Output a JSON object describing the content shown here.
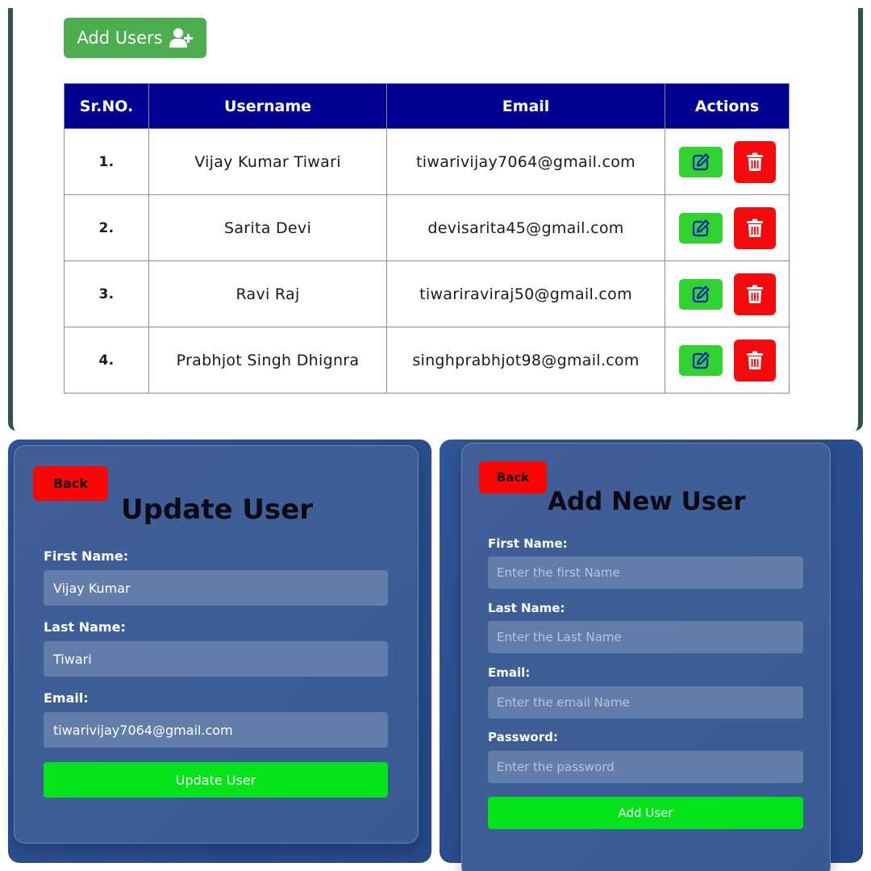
{
  "users_table": {
    "add_button_label": "Add Users",
    "columns": [
      "Sr.NO.",
      "Username",
      "Email",
      "Actions"
    ],
    "rows": [
      {
        "num": "1.",
        "username": "Vijay Kumar Tiwari",
        "email": "tiwarivijay7064@gmail.com"
      },
      {
        "num": "2.",
        "username": "Sarita Devi",
        "email": "devisarita45@gmail.com"
      },
      {
        "num": "3.",
        "username": "Ravi Raj",
        "email": "tiwariraviraj50@gmail.com"
      },
      {
        "num": "4.",
        "username": "Prabhjot Singh Dhignra",
        "email": "singhprabhjot98@gmail.com"
      }
    ],
    "action_icons": [
      "edit-icon",
      "trash-icon"
    ]
  },
  "update_form": {
    "back_label": "Back",
    "title": "Update User",
    "first_name_label": "First Name:",
    "first_name_value": "Vijay Kumar",
    "last_name_label": "Last Name:",
    "last_name_value": "Tiwari",
    "email_label": "Email:",
    "email_value": "tiwarivijay7064@gmail.com",
    "submit_label": "Update User"
  },
  "add_form": {
    "back_label": "Back",
    "title": "Add New User",
    "first_name_label": "First Name:",
    "first_name_placeholder": "Enter the first Name",
    "last_name_label": "Last Name:",
    "last_name_placeholder": "Enter the Last Name",
    "email_label": "Email:",
    "email_placeholder": "Enter the email Name",
    "password_label": "Password:",
    "password_placeholder": "Enter the password",
    "submit_label": "Add User"
  },
  "colors": {
    "table_header": "#000093",
    "add_users_button": "#4cae4f",
    "edit_button": "#2fd22f",
    "delete_button": "#f50b0b",
    "back_button": "#fb0505",
    "submit_button": "#05e31a",
    "panel_background": "#2f5699"
  }
}
